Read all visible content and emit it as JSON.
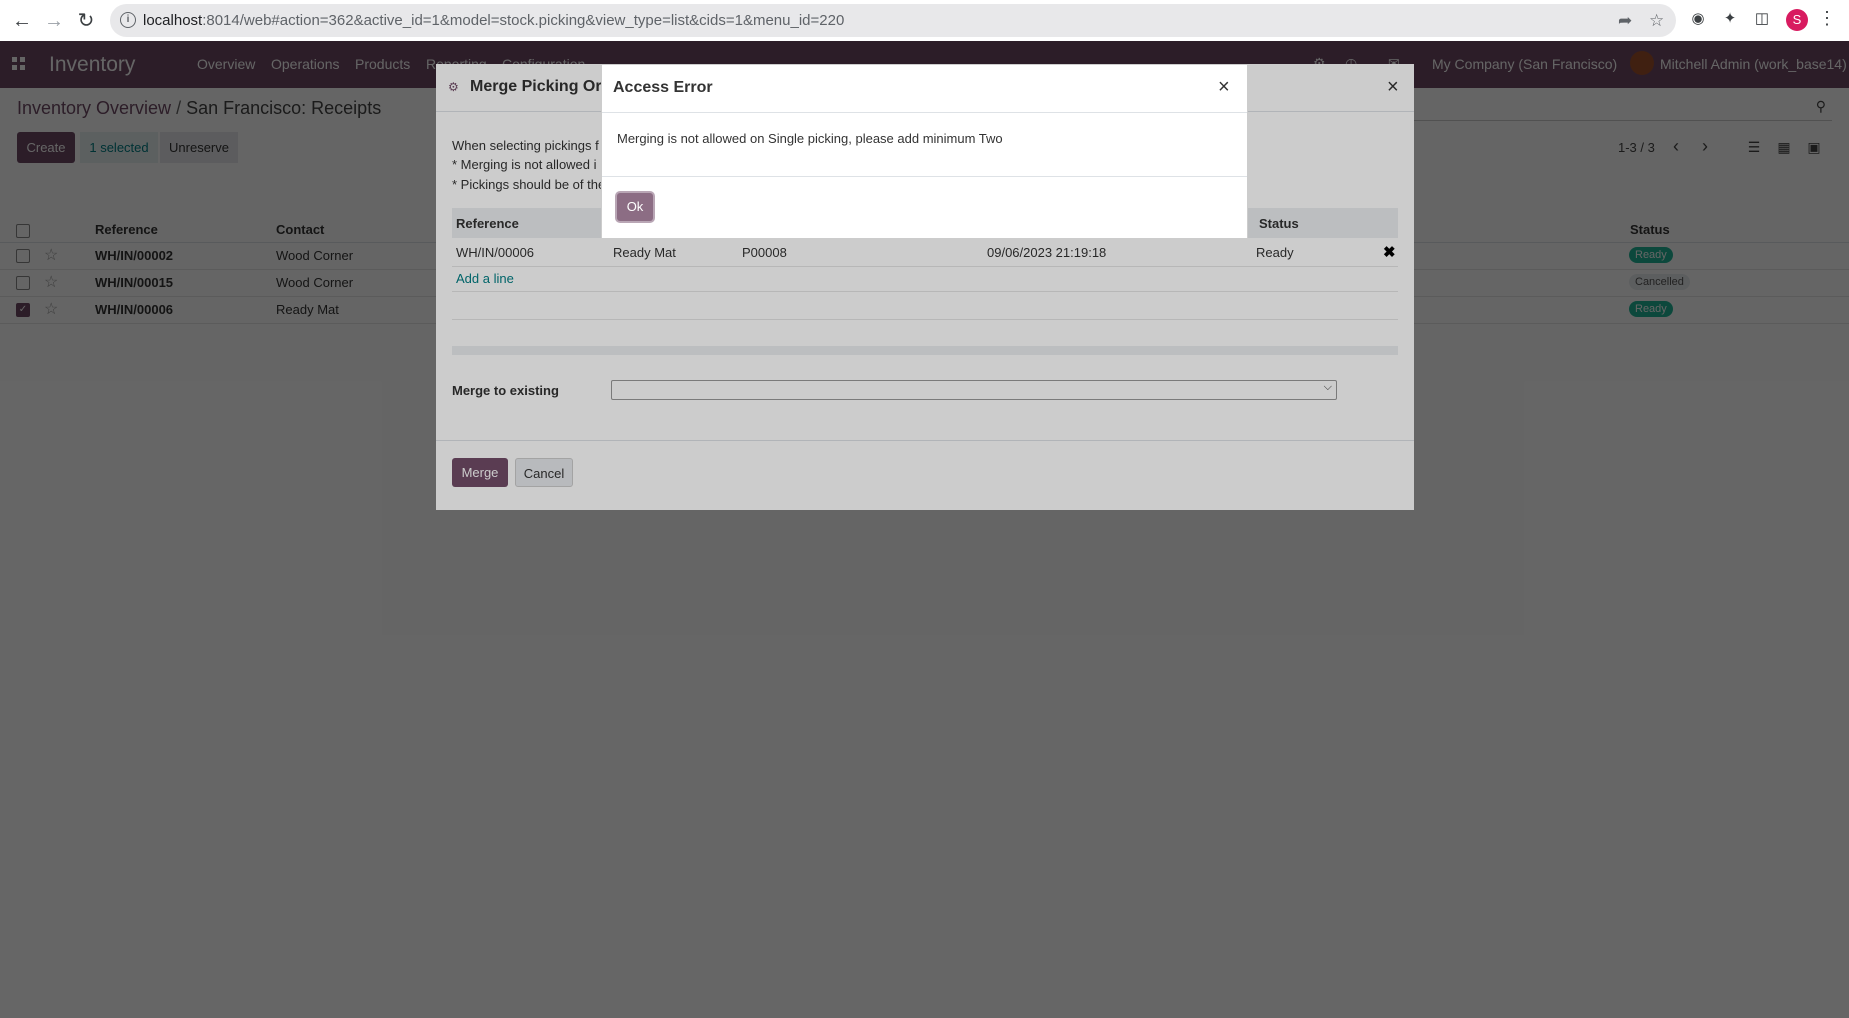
{
  "browser": {
    "url_host": "localhost",
    "url_rest": ":8014/web#action=362&active_id=1&model=stock.picking&view_type=list&cids=1&menu_id=220",
    "profile_initial": "S"
  },
  "topbar": {
    "brand": "Inventory",
    "menu": [
      "Overview",
      "Operations",
      "Products",
      "Reporting",
      "Configuration"
    ],
    "company": "My Company (San Francisco)",
    "user": "Mitchell Admin (work_base14)"
  },
  "control": {
    "breadcrumb_parent": "Inventory Overview",
    "breadcrumb_sep": "/",
    "breadcrumb_current": "San Francisco: Receipts",
    "create_label": "Create",
    "selected_label": "1 selected",
    "unreserve_label": "Unreserve",
    "pager": "1-3 / 3"
  },
  "list": {
    "headers": {
      "reference": "Reference",
      "contact": "Contact",
      "status": "Status"
    },
    "rows": [
      {
        "reference": "WH/IN/00002",
        "contact": "Wood Corner",
        "status": "Ready",
        "checked": false
      },
      {
        "reference": "WH/IN/00015",
        "contact": "Wood Corner",
        "status": "Cancelled",
        "checked": false
      },
      {
        "reference": "WH/IN/00006",
        "contact": "Ready Mat",
        "status": "Ready",
        "checked": true
      }
    ]
  },
  "merge_dialog": {
    "title": "Merge Picking Orders",
    "help": [
      "When selecting pickings f",
      "* Merging is not allowed i",
      "* Pickings should be of the"
    ],
    "headers": {
      "reference": "Reference",
      "status": "Status"
    },
    "row": {
      "reference": "WH/IN/00006",
      "contact": "Ready Mat",
      "source": "P00008",
      "date": "09/06/2023 21:19:18",
      "status": "Ready"
    },
    "add_line": "Add a line",
    "merge_to_existing_label": "Merge to existing",
    "merge_label": "Merge",
    "cancel_label": "Cancel"
  },
  "error_dialog": {
    "title": "Access Error",
    "message": "Merging is not allowed on Single picking, please add minimum Two",
    "ok_label": "Ok"
  },
  "colors": {
    "brand": "#714b67",
    "accent": "#017e84",
    "ready": "#21b799"
  }
}
